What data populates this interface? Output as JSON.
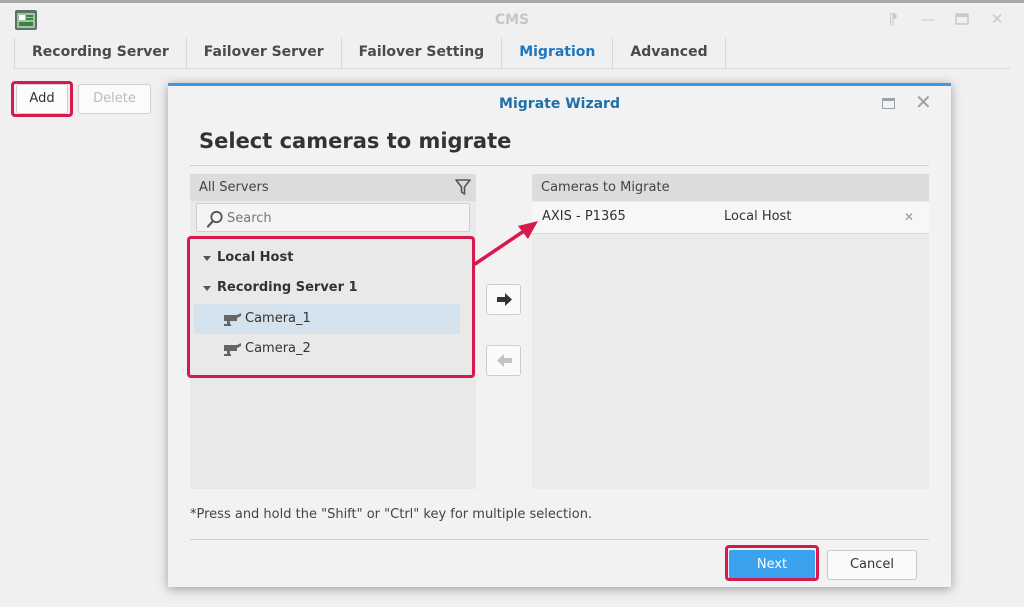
{
  "window": {
    "title": "CMS",
    "controls": [
      "pin-icon",
      "minimize-icon",
      "maximize-icon",
      "close-icon"
    ]
  },
  "tabs": [
    {
      "label": "Recording Server",
      "active": false
    },
    {
      "label": "Failover Server",
      "active": false
    },
    {
      "label": "Failover Setting",
      "active": false
    },
    {
      "label": "Migration",
      "active": true
    },
    {
      "label": "Advanced",
      "active": false
    }
  ],
  "toolbar": {
    "add_label": "Add",
    "delete_label": "Delete"
  },
  "wizard": {
    "title": "Migrate Wizard",
    "heading": "Select cameras to migrate",
    "left_panel": {
      "header": "All Servers",
      "search_placeholder": "Search",
      "tree": [
        {
          "label": "Local Host",
          "type": "server",
          "expanded": true
        },
        {
          "label": "Recording Server 1",
          "type": "server",
          "expanded": true
        },
        {
          "label": "Camera_1",
          "type": "camera",
          "selected": true
        },
        {
          "label": "Camera_2",
          "type": "camera",
          "selected": false
        }
      ]
    },
    "right_panel": {
      "header": "Cameras to Migrate",
      "rows": [
        {
          "camera": "AXIS - P1365",
          "server": "Local Host"
        }
      ]
    },
    "note": "*Press and hold the \"Shift\" or \"Ctrl\" key for multiple selection.",
    "next_label": "Next",
    "cancel_label": "Cancel"
  },
  "colors": {
    "accent": "#1b77c1",
    "primary_button": "#3aa2ee",
    "highlight": "#d61a4e",
    "selection": "#d3e2ec"
  }
}
